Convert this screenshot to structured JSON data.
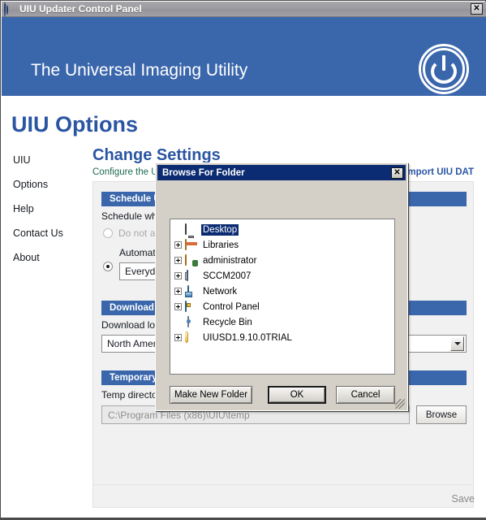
{
  "window": {
    "title": "UIU Updater Control Panel",
    "icon": "power-logo-icon",
    "close_label": "✕"
  },
  "banner": {
    "title": "The Universal Imaging Utility",
    "logo": "power-button-logo"
  },
  "page": {
    "title": "UIU Options"
  },
  "sidebar": {
    "items": [
      {
        "label": "UIU"
      },
      {
        "label": "Options"
      },
      {
        "label": "Help"
      },
      {
        "label": "Contact Us"
      },
      {
        "label": "About"
      }
    ]
  },
  "content": {
    "heading": "Change Settings",
    "subheading": "Configure the UIU Updater",
    "import_link": "Import UIU DAT",
    "sections": {
      "schedule": {
        "header": "Schedule Update",
        "label": "Schedule when updates are downloaded",
        "radio_manual": "Do not automatically download updates",
        "radio_auto": "Automatically download updates",
        "frequency_value": "Everyday"
      },
      "download": {
        "header": "Download Location",
        "label": "Download location for updates",
        "region_value": "North America"
      },
      "temp": {
        "header": "Temporary Directory",
        "label": "Temp directory used by the UIU",
        "path_value": "C:\\Program Files (x86)\\UIU\\temp",
        "browse_label": "Browse"
      }
    },
    "save_label": "Save"
  },
  "browse_dialog": {
    "title": "Browse For Folder",
    "close_label": "✕",
    "tree": [
      {
        "label": "Desktop",
        "icon": "monitor-icon",
        "expandable": false,
        "selected": true,
        "indent": 0
      },
      {
        "label": "Libraries",
        "icon": "libraries-icon",
        "expandable": true,
        "selected": false,
        "indent": 0
      },
      {
        "label": "administrator",
        "icon": "user-folder-icon",
        "expandable": true,
        "selected": false,
        "indent": 0
      },
      {
        "label": "SCCM2007",
        "icon": "computer-icon",
        "expandable": true,
        "selected": false,
        "indent": 0
      },
      {
        "label": "Network",
        "icon": "network-icon",
        "expandable": true,
        "selected": false,
        "indent": 0
      },
      {
        "label": "Control Panel",
        "icon": "control-panel-icon",
        "expandable": true,
        "selected": false,
        "indent": 0
      },
      {
        "label": "Recycle Bin",
        "icon": "recycle-bin-icon",
        "expandable": false,
        "selected": false,
        "indent": 0
      },
      {
        "label": "UIUSD1.9.10.0TRIAL",
        "icon": "folder-icon",
        "expandable": true,
        "selected": false,
        "indent": 0
      }
    ],
    "buttons": {
      "make_new_folder": "Make New Folder",
      "ok": "OK",
      "cancel": "Cancel"
    }
  },
  "colors": {
    "banner_blue": "#3a66ab",
    "heading_blue": "#2a55a2",
    "sub_green": "#1d6a4e",
    "dialog_titlebar": "#0b2c72",
    "dialog_face": "#d4d0c8",
    "card_bg": "#f1f1f1"
  }
}
